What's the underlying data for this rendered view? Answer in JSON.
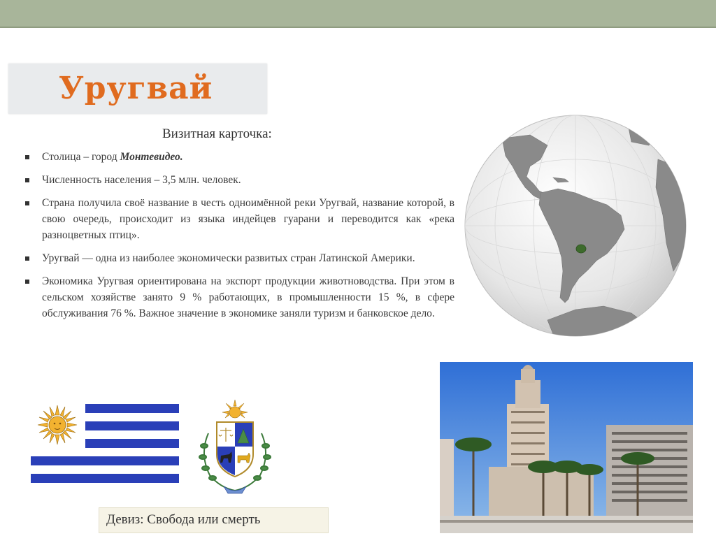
{
  "slide": {
    "title": "Уругвай",
    "card_heading": "Визитная карточка:",
    "bullets": [
      {
        "prefix": "Столица – город ",
        "emph": "Монтевидео."
      },
      {
        "text": "Численность населения – 3,5 млн. человек."
      },
      {
        "text": "Страна получила своё название в честь одноимённой реки Уругвай, название которой, в свою очередь, происходит из языка индейцев гуарани и переводится как «река разноцветных птиц»."
      },
      {
        "text": "Уругвай — одна из наиболее экономически развитых стран Латинской Америки."
      },
      {
        "text": "Экономика Уругвая ориентирована на экспорт продукции животноводства. При этом в сельском хозяйстве занято 9 % работающих, в промышленности 15 %, в сфере обслуживания 76 %. Важное значение в экономике заняли туризм и банковское дело."
      }
    ],
    "motto": "Девиз: Свобода или смерть"
  },
  "colors": {
    "title_orange": "#e06b1f",
    "top_bar": "#a8b59a",
    "flag_blue": "#2a3fb8",
    "sun_gold": "#f2b230",
    "uruguay_highlight": "#3d6b2c"
  },
  "icons": {
    "globe": "globe-map-icon",
    "flag": "uruguay-flag-icon",
    "coat": "coat-of-arms-icon",
    "photo": "montevideo-photo"
  }
}
